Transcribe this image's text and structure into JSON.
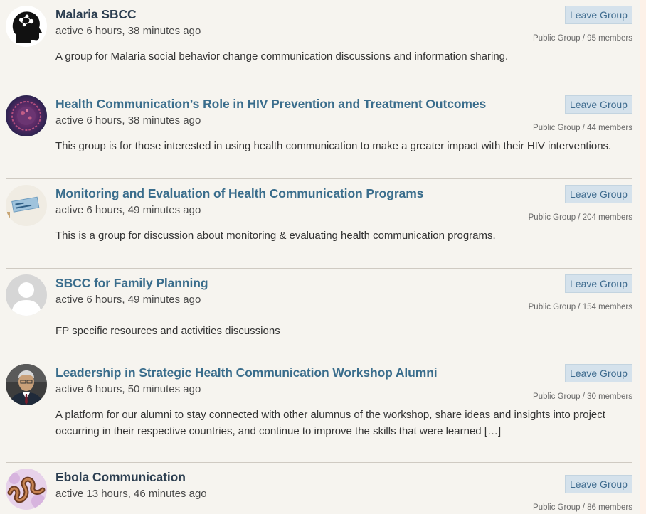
{
  "leave_label": "Leave Group",
  "groups": [
    {
      "title": "Malaria SBCC",
      "activity": "active 6 hours, 38 minutes ago",
      "description": "A group for Malaria social behavior change communication discussions and information sharing.",
      "meta": "Public Group / 95 members",
      "avatar_icon": "head-silhouette-icon"
    },
    {
      "title": "Health Communication’s Role in HIV Prevention and Treatment Outcomes",
      "activity": "active 6 hours, 38 minutes ago",
      "description": "This group is for those interested in using health communication to make a greater impact with their HIV interventions.",
      "meta": "Public Group / 44 members",
      "avatar_icon": "virus-image-icon"
    },
    {
      "title": "Monitoring and Evaluation of Health Communication Programs",
      "activity": "active 6 hours, 49 minutes ago",
      "description": "This is a group for discussion about monitoring & evaluating health communication programs.",
      "meta": "Public Group / 204 members",
      "avatar_icon": "note-card-icon"
    },
    {
      "title": "SBCC for Family Planning",
      "activity": "active 6 hours, 49 minutes ago",
      "description": "FP specific resources and activities discussions",
      "meta": "Public Group / 154 members",
      "avatar_icon": "default-user-icon"
    },
    {
      "title": "Leadership in Strategic Health Communication Workshop Alumni",
      "activity": "active 6 hours, 50 minutes ago",
      "description": "A platform for our alumni to stay connected with other alumnus of the workshop, share ideas and insights into project occurring in their respective countries, and continue to improve the skills that were learned […]",
      "meta": "Public Group / 30 members",
      "avatar_icon": "person-photo-icon"
    },
    {
      "title": "Ebola Communication",
      "activity": "active 13 hours, 46 minutes ago",
      "description": "",
      "meta": "Public Group / 86 members",
      "avatar_icon": "ebola-virus-icon"
    }
  ],
  "colors": {
    "link": "#3a6d8c",
    "button_bg": "#d5e2ec",
    "page_bg": "#f6f4ef"
  }
}
